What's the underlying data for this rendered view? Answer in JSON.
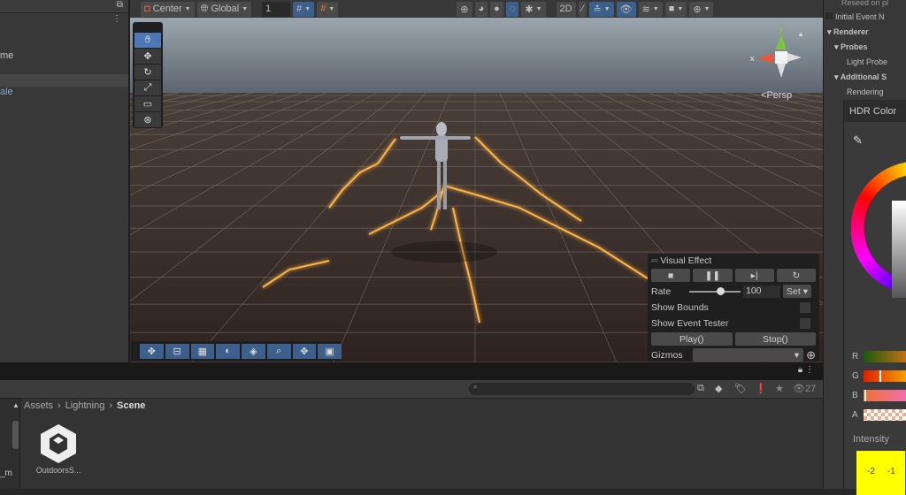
{
  "hierarchy": {
    "items": [
      {
        "label": "me"
      },
      {
        "label": "ale"
      }
    ]
  },
  "toolbar": {
    "pivot": "Center",
    "space": "Global",
    "grid_value": "1"
  },
  "scene": {
    "projection": "Persp",
    "axes": {
      "x": "x",
      "y": "y"
    }
  },
  "visual_effect": {
    "title": "Visual Effect",
    "rate_label": "Rate",
    "rate_value": "100",
    "rate_fraction": 0.6,
    "set_label": "Set",
    "show_bounds": "Show Bounds",
    "show_event_tester": "Show Event Tester",
    "play": "Play()",
    "stop": "Stop()",
    "gizmos": "Gizmos"
  },
  "inspector": {
    "lines": [
      "Reseed on pl",
      "Initial Event N",
      "Renderer",
      "Probes",
      "Light Probe",
      "Additional S",
      "Rendering"
    ]
  },
  "color_picker": {
    "title": "HDR Color",
    "channels": [
      "R",
      "G",
      "B",
      "A"
    ],
    "intensity_label": "Intensity",
    "intensity_ticks": [
      "-2",
      "-1"
    ]
  },
  "project": {
    "breadcrumb": [
      "Assets",
      "Lightning",
      "Scene"
    ],
    "asset_name": "OutdoorsS...",
    "visible_count": "27",
    "side_label": "_m"
  }
}
